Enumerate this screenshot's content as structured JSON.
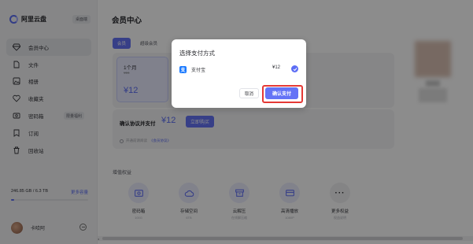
{
  "brand": {
    "name": "阿里云盘",
    "badge": "桌面端"
  },
  "sidebar": {
    "items": [
      {
        "label": "会员中心",
        "icon": "gem-icon",
        "active": true
      },
      {
        "label": "文件",
        "icon": "file-icon"
      },
      {
        "label": "相册",
        "icon": "photo-icon"
      },
      {
        "label": "收藏夹",
        "icon": "heart-icon"
      },
      {
        "label": "密码箱",
        "icon": "safe-icon",
        "tag": "限量福利"
      },
      {
        "label": "订阅",
        "icon": "bookmark-icon"
      },
      {
        "label": "回收站",
        "icon": "trash-icon"
      }
    ],
    "storage": {
      "used": "246.85 GB / 6.3 TB",
      "more": "更多容量",
      "fill_fraction": 0.04
    },
    "user": {
      "name": "卡哈阿"
    }
  },
  "main": {
    "title": "会员中心",
    "tabs": [
      {
        "label": "会员",
        "active": true
      },
      {
        "label": "超级会员"
      }
    ],
    "plan": {
      "name": "1个月",
      "original_price": "¥15",
      "price": "¥12"
    },
    "confirm": {
      "label": "确认协议并支付",
      "price": "¥12",
      "buy_label": "立即购买"
    },
    "agreement": {
      "text": "开通前请阅读",
      "link": "《会员协议》"
    },
    "perks_title": "增值权益",
    "perks": [
      {
        "name": "密码箱",
        "sub": "100G",
        "icon": "safe-icon"
      },
      {
        "name": "存储空间",
        "sub": "6TB",
        "icon": "cloud-icon"
      },
      {
        "name": "云解压",
        "sub": "在线解压缩",
        "icon": "archive-icon"
      },
      {
        "name": "高清播放",
        "sub": "1080P",
        "icon": "screen-icon"
      },
      {
        "name": "更多权益",
        "sub": "权益说明",
        "icon": "more-icon"
      }
    ]
  },
  "dialog": {
    "title": "选择支付方式",
    "method": "支付宝",
    "method_icon": "alipay-icon",
    "price": "¥12",
    "cancel_label": "取消",
    "confirm_label": "确认支付"
  },
  "colors": {
    "accent": "#6473f6",
    "highlight": "#e53935"
  }
}
